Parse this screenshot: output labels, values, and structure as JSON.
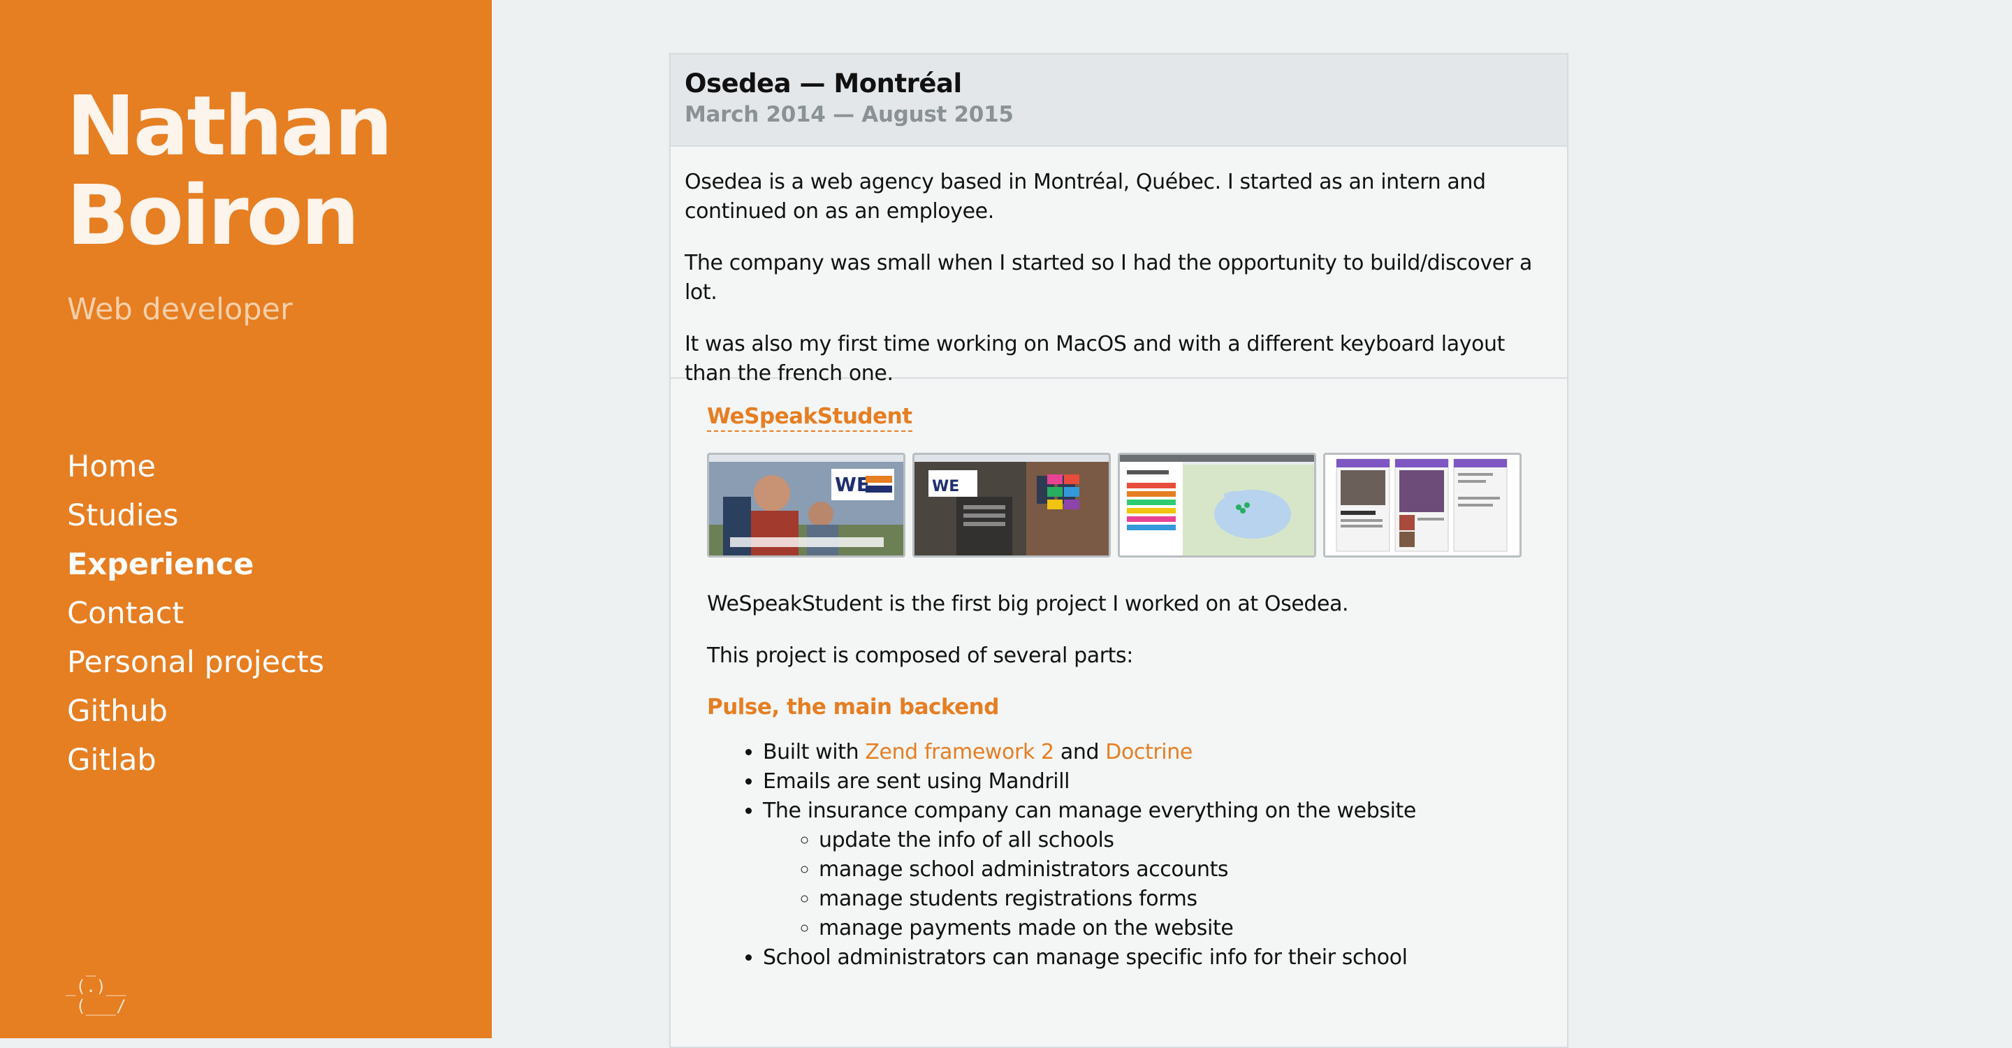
{
  "sidebar": {
    "name_line1": "Nathan",
    "name_line2": "Boiron",
    "tagline": "Web developer",
    "nav": [
      {
        "label": "Home"
      },
      {
        "label": "Studies"
      },
      {
        "label": "Experience",
        "active": true
      },
      {
        "label": "Contact"
      },
      {
        "label": "Personal projects"
      },
      {
        "label": "Github"
      },
      {
        "label": "Gitlab"
      }
    ],
    "logo_ascii": "  _\n_(.)__\n (___/"
  },
  "job": {
    "company": "Osedea — Montréal",
    "period": "March 2014 — August 2015",
    "intro": [
      "Osedea is a web agency based in Montréal, Québec. I started as an intern and continued on as an employee.",
      "The company was small when I started so I had the opportunity to build/discover a lot.",
      "It was also my first time working on MacOS and with a different keyboard layout than the french one."
    ]
  },
  "project": {
    "title": "WeSpeakStudent",
    "thumbnails": [
      {
        "name": "homepage-screenshot"
      },
      {
        "name": "school-page-screenshot"
      },
      {
        "name": "find-a-specialist-map-screenshot"
      },
      {
        "name": "mobile-app-screenshot"
      }
    ],
    "paragraphs": [
      "WeSpeakStudent is the first big project I worked on at Osedea.",
      "This project is composed of several parts:"
    ],
    "section_title": "Pulse, the main backend",
    "features": {
      "built_prefix": "Built with ",
      "zend_link": "Zend framework 2",
      "and_word": " and ",
      "doctrine_link": "Doctrine",
      "emails": "Emails are sent using Mandrill",
      "insurance": "The insurance company can manage everything on the website",
      "insurance_sub": [
        "update the info of all schools",
        "manage school administrators accounts",
        "manage students registrations forms",
        "manage payments made on the website"
      ],
      "admins": "School administrators can manage specific info for their school"
    }
  },
  "colors": {
    "accent": "#e67e22",
    "background": "#eef1f2",
    "card": "#f4f6f6",
    "card_header": "#e3e7e9",
    "muted": "#8b9295"
  }
}
